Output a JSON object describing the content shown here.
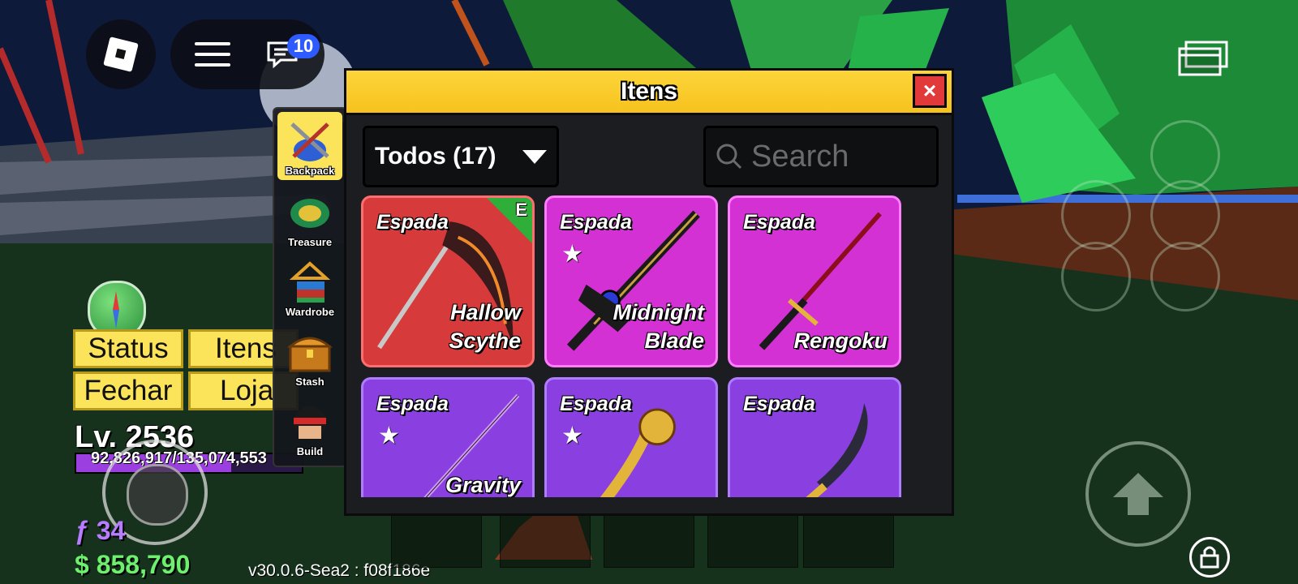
{
  "topbar": {
    "chat_badge": "10",
    "icons": [
      "roblox-logo-icon",
      "hamburger-menu-icon",
      "chat-icon",
      "screen-icon"
    ]
  },
  "hud": {
    "buttons": [
      {
        "label": "Status"
      },
      {
        "label": "Itens"
      },
      {
        "label": "Fechar"
      },
      {
        "label": "Loja"
      }
    ],
    "level": "Lv. 2536",
    "xp_text": "92,826,917/135,074,553",
    "xp_fraction": 0.687,
    "fragments": "ƒ 34",
    "money": "$ 858,790",
    "version": "v30.0.6-Sea2 : f08f186e"
  },
  "side_tabs": [
    {
      "label": "Backpack",
      "active": true
    },
    {
      "label": "Treasure",
      "active": false
    },
    {
      "label": "Wardrobe",
      "active": false
    },
    {
      "label": "Stash",
      "active": false
    },
    {
      "label": "Build",
      "active": false
    }
  ],
  "inventory": {
    "title": "Itens",
    "close_label": "×",
    "filter_label": "Todos (17)",
    "search_placeholder": "Search",
    "equipped_marker": "E",
    "items": [
      {
        "type": "Espada",
        "name": "Hallow Scythe",
        "starred": false,
        "equipped": true,
        "rarity": "red"
      },
      {
        "type": "Espada",
        "name": "Midnight Blade",
        "starred": true,
        "equipped": false,
        "rarity": "pink"
      },
      {
        "type": "Espada",
        "name": "Rengoku",
        "starred": false,
        "equipped": false,
        "rarity": "pink"
      },
      {
        "type": "Espada",
        "name": "Gravity",
        "starred": true,
        "equipped": false,
        "rarity": "purple"
      },
      {
        "type": "Espada",
        "name": "",
        "starred": true,
        "equipped": false,
        "rarity": "purple"
      },
      {
        "type": "Espada",
        "name": "",
        "starred": false,
        "equipped": false,
        "rarity": "purple"
      }
    ]
  },
  "colors": {
    "title_bar": "#f7c21e",
    "rarity_red": "#d63a3a",
    "rarity_pink": "#d331d3",
    "rarity_purple": "#8a3fe0",
    "equip_green": "#2fae3a"
  }
}
